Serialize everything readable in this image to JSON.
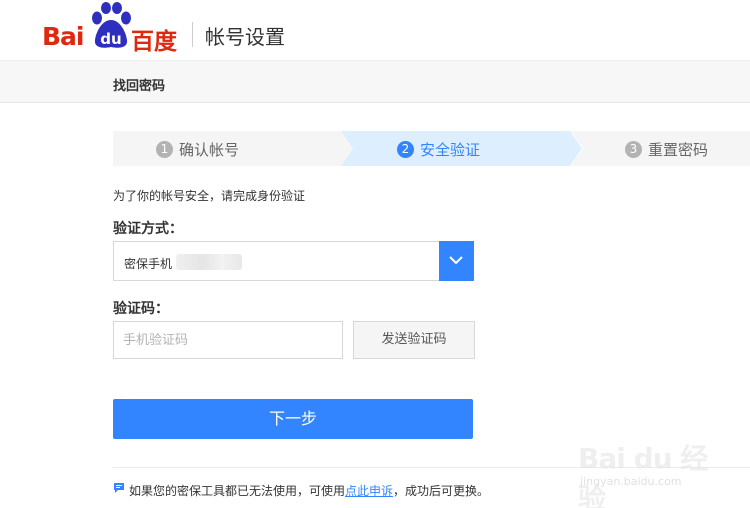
{
  "header": {
    "logo_bai": "Bai",
    "logo_du": "du",
    "logo_cn": "百度",
    "title": "帐号设置"
  },
  "subbar": {
    "title": "找回密码"
  },
  "steps": [
    {
      "num": "1",
      "label": "确认帐号",
      "active": false
    },
    {
      "num": "2",
      "label": "安全验证",
      "active": true
    },
    {
      "num": "3",
      "label": "重置密码",
      "active": false
    }
  ],
  "intro_text": "为了你的帐号安全，请完成身份验证",
  "method": {
    "label": "验证方式：",
    "selected": "密保手机"
  },
  "code": {
    "label": "验证码：",
    "placeholder": "手机验证码",
    "send_label": "发送验证码"
  },
  "next_label": "下一步",
  "footer": {
    "text_before": "如果您的密保工具都已无法使用，可使用",
    "link": "点此申诉",
    "text_after": "，成功后可更换。"
  },
  "watermark": {
    "main": "Bai du 经验",
    "sub": "jingyan.baidu.com"
  },
  "colors": {
    "brand_red": "#de2910",
    "brand_blue": "#2f2fbf",
    "accent": "#3385ff",
    "step_active_bg": "#ddeeff",
    "step_inactive_bg": "#f5f5f5"
  }
}
